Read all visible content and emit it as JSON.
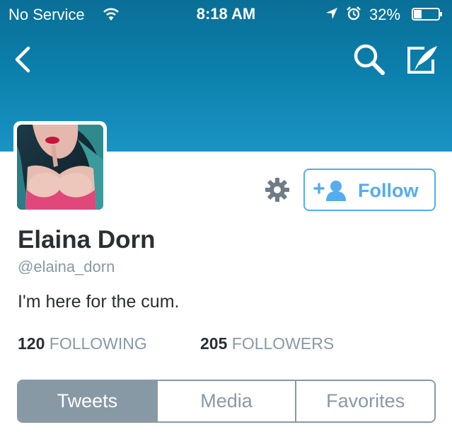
{
  "status_bar": {
    "carrier": "No Service",
    "time": "8:18 AM",
    "battery": "32%",
    "battery_level": 0.32,
    "icons": [
      "wifi-icon",
      "location-arrow-icon",
      "alarm-icon",
      "battery-icon"
    ]
  },
  "nav": {
    "icons": [
      "back-chevron-icon",
      "search-icon",
      "compose-tweet-icon"
    ]
  },
  "profile": {
    "name": "Elaina Dorn",
    "handle": "@elaina_dorn",
    "bio": "I'm here for the cum.",
    "follow_label": "Follow",
    "following_count": "120",
    "following_label": "FOLLOWING",
    "followers_count": "205",
    "followers_label": "FOLLOWERS"
  },
  "tabs": [
    {
      "label": "Tweets",
      "active": true
    },
    {
      "label": "Media",
      "active": false
    },
    {
      "label": "Favorites",
      "active": false
    }
  ],
  "colors": {
    "header": "#0b7fab",
    "accent": "#55acee",
    "muted": "#8899a6",
    "text": "#292f33"
  }
}
